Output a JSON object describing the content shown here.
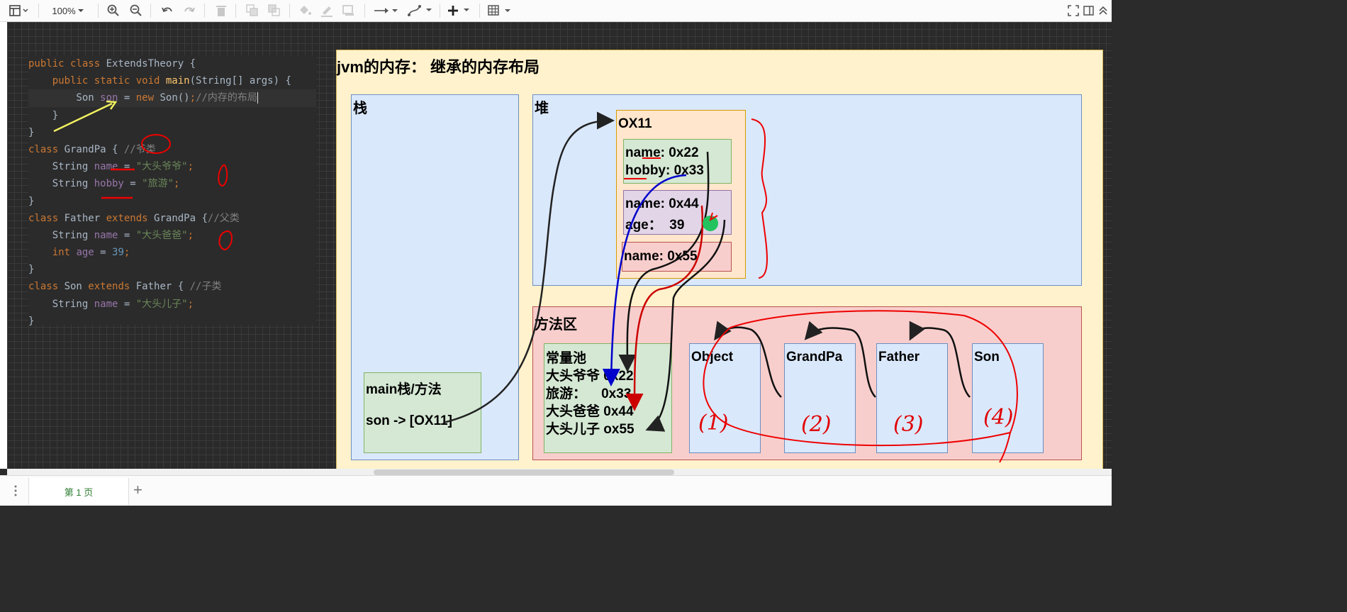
{
  "toolbar": {
    "zoom": "100%"
  },
  "code": {
    "lines": [
      "public class ExtendsTheory {",
      "    public static void main(String[] args) {",
      "        Son son = new Son();//内存的布局",
      "    }",
      "}",
      "class GrandPa { //爷类",
      "    String name = \"大头爷爷\";",
      "    String hobby = \"旅游\";",
      "}",
      "class Father extends GrandPa {//父类",
      "    String name = \"大头爸爸\";",
      "    int age = 39;",
      "}",
      "class Son extends Father { //子类",
      "    String name = \"大头儿子\";",
      "}"
    ]
  },
  "diagram": {
    "title": "jvm的内存： 继承的内存布局",
    "stack": {
      "label": "栈",
      "frame_title": "main栈/方法",
      "frame_value": "son -> [OX11]"
    },
    "heap": {
      "label": "堆",
      "object": {
        "address": "OX11",
        "grandpa_fields": [
          "name: 0x22",
          "hobby: 0x33"
        ],
        "father_fields": [
          "name: 0x44",
          "age：  39"
        ],
        "son_fields": [
          "name: 0x55"
        ]
      }
    },
    "method_area": {
      "label": "方法区",
      "constant_pool": {
        "title": "常量池",
        "entries": [
          "大头爷爷 0x22",
          "旅游：    0x33",
          "大头爸爸 0x44",
          "大头儿子 ox55"
        ]
      },
      "classes": [
        "Object",
        "GrandPa",
        "Father",
        "Son"
      ]
    },
    "annotations": {
      "numbers": [
        "(1)",
        "(2)",
        "(3)",
        "(4)"
      ]
    }
  },
  "bottom": {
    "page_tab": "第 1 页",
    "add_page": "+"
  },
  "colors": {
    "yellow_box": "#fff2cc",
    "blue_box": "#dae8fc",
    "red_box": "#f8cecc",
    "green_box": "#d5e8d4",
    "orange_box": "#ffe6cc",
    "purple_box": "#e1d5e7",
    "annotation_red": "#e00000",
    "arrow_blue": "#0000cc"
  }
}
